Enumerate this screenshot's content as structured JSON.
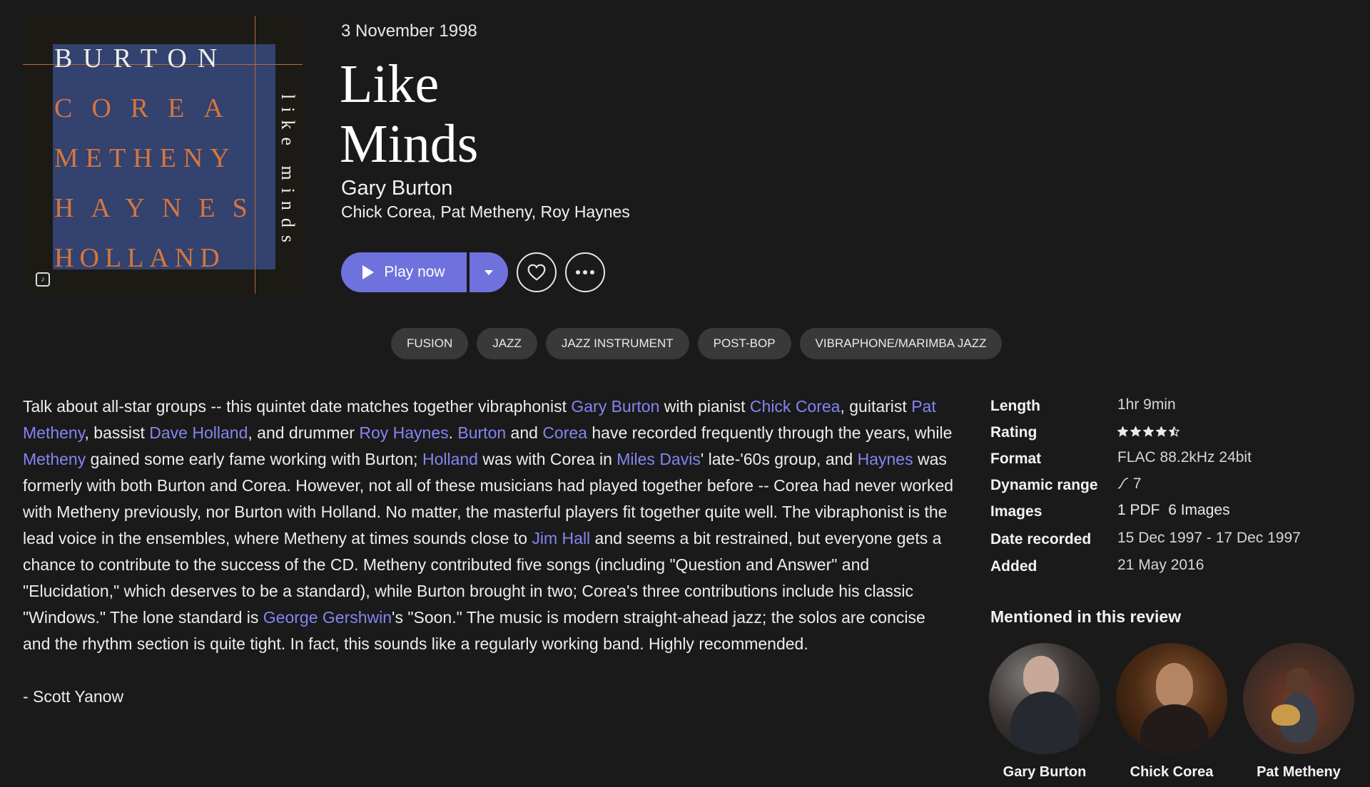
{
  "cover": {
    "names": [
      "BURTON",
      "COREA",
      "METHENY",
      "HAYNES",
      "HOLLAND"
    ],
    "side_title": "like minds",
    "colors": {
      "panel": "#33426e",
      "accent": "#d7763c"
    }
  },
  "album": {
    "release_date": "3 November 1998",
    "title_line1": "Like",
    "title_line2": "Minds",
    "main_artist": "Gary Burton",
    "other_artists": "Chick Corea, Pat Metheny, Roy Haynes"
  },
  "actions": {
    "play_label": "Play now",
    "accent": "#6f72dc"
  },
  "genres": [
    "FUSION",
    "JAZZ",
    "JAZZ INSTRUMENT",
    "POST-BOP",
    "VIBRAPHONE/MARIMBA JAZZ"
  ],
  "review": {
    "t1": "Talk about all-star groups -- this quintet date matches together vibraphonist ",
    "l_gary_burton": "Gary Burton",
    "t2": " with pianist ",
    "l_chick_corea": "Chick Corea",
    "t3": ", guitarist ",
    "l_pat_metheny": "Pat Metheny",
    "t4": ", bassist ",
    "l_dave_holland": "Dave Holland",
    "t5": ", and drummer ",
    "l_roy_haynes": "Roy Haynes",
    "t6": ". ",
    "l_burton": "Burton",
    "t7": " and ",
    "l_corea": "Corea",
    "t8": " have recorded frequently through the years, while ",
    "l_metheny": "Metheny",
    "t9": " gained some early fame working with Burton; ",
    "l_holland": "Holland",
    "t10": " was with Corea in ",
    "l_miles_davis": "Miles Davis",
    "t11": "' late-'60s group, and ",
    "l_haynes": "Haynes",
    "t12": " was formerly with both Burton and Corea. However, not all of these musicians had played together before -- Corea had never worked with Metheny previously, nor Burton with Holland. No matter, the masterful players fit together quite well. The vibraphonist is the lead voice in the ensembles, where Metheny at times sounds close to ",
    "l_jim_hall": "Jim Hall",
    "t13": " and seems a bit restrained, but everyone gets a chance to contribute to the success of the CD. Metheny contributed five songs (including \"Question and Answer\" and \"Elucidation,\" which deserves to be a standard), while Burton brought in two; Corea's three contributions include his classic \"Windows.\" The lone standard is ",
    "l_george_gershwin": "George Gershwin",
    "t14": "'s \"Soon.\" The music is modern straight-ahead jazz; the solos are concise and the rhythm section is quite tight. In fact, this sounds like a regularly working band. Highly recommended.",
    "author": "- Scott Yanow",
    "link_color": "#8585f2"
  },
  "details": {
    "length_label": "Length",
    "length": "1hr 9min",
    "rating_label": "Rating",
    "rating": 4.5,
    "format_label": "Format",
    "format": "FLAC 88.2kHz 24bit",
    "dr_label": "Dynamic range",
    "dr_value": "7",
    "images_label": "Images",
    "pdf": "1 PDF",
    "images": "6 Images",
    "recorded_label": "Date recorded",
    "recorded": "15 Dec 1997 - 17 Dec 1997",
    "added_label": "Added",
    "added": "21 May 2016"
  },
  "mentioned": {
    "title": "Mentioned in this review",
    "people": [
      "Gary Burton",
      "Chick Corea",
      "Pat Metheny"
    ]
  }
}
